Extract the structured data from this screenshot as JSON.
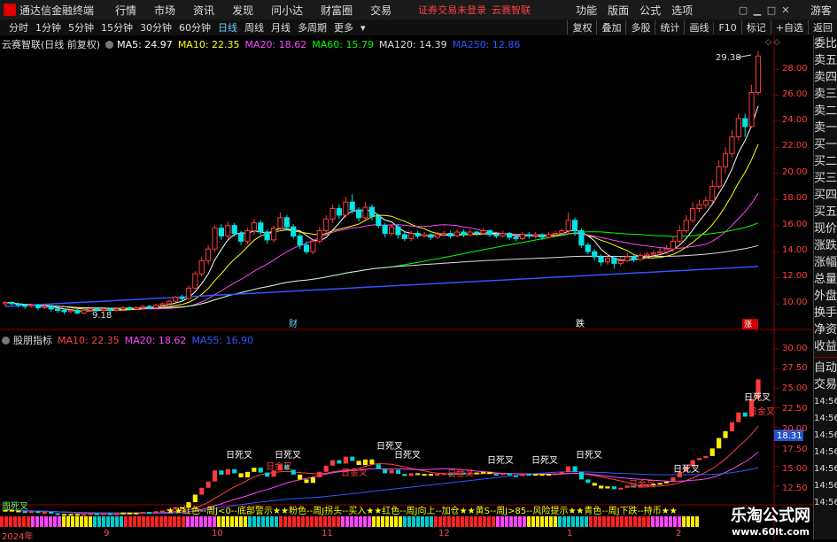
{
  "menubar": {
    "title": "通达信金融终端",
    "items": [
      "行情",
      "市场",
      "资讯",
      "发现",
      "问小达",
      "财富圈",
      "交易"
    ],
    "warning": "证券交易未登录",
    "stock": "云赛智联",
    "right_items": [
      "功能",
      "版面",
      "公式",
      "选项"
    ],
    "user": "游客"
  },
  "periods": {
    "tabs": [
      "分时",
      "1分钟",
      "5分钟",
      "15分钟",
      "30分钟",
      "60分钟",
      "日线",
      "周线",
      "月线",
      "多周期",
      "更多"
    ],
    "active": "日线",
    "right_tabs": [
      "复权",
      "叠加",
      "多股",
      "统计",
      "画线",
      "F10",
      "标记",
      "+自选",
      "返回"
    ]
  },
  "main_legend": {
    "name": "云赛智联(日线 前复权)",
    "ma": [
      {
        "label": "MA5: 24.97",
        "color": "#ffffff"
      },
      {
        "label": "MA10: 22.35",
        "color": "#ffff00"
      },
      {
        "label": "MA20: 18.62",
        "color": "#ff44ff"
      },
      {
        "label": "MA60: 15.79",
        "color": "#00ff00"
      },
      {
        "label": "MA120: 14.39",
        "color": "#dddddd"
      },
      {
        "label": "MA250: 12.86",
        "color": "#3355ff"
      }
    ]
  },
  "sub_legend": {
    "name": "股朋指标",
    "ma": [
      {
        "label": "MA10: 22.35",
        "color": "#ff4444"
      },
      {
        "label": "MA20: 18.62",
        "color": "#ff44ff"
      },
      {
        "label": "MA55: 16.90",
        "color": "#3355ff"
      }
    ]
  },
  "main_axis": [
    "28.00",
    "26.00",
    "24.00",
    "22.00",
    "20.00",
    "18.00",
    "16.00",
    "14.00",
    "12.00",
    "10.00"
  ],
  "sub_axis": [
    "30.00",
    "27.50",
    "25.00",
    "22.50",
    "20.00",
    "17.50",
    "15.00",
    "12.50"
  ],
  "sub_current": "18.31",
  "annotations": {
    "high": "29.38",
    "low": "9.18",
    "markers": [
      "财",
      "跌",
      "涨"
    ]
  },
  "sub_tags": [
    "日死叉",
    "日金叉"
  ],
  "ticker_text": "★★红色--周J<0--底部警示★★粉色--周J拐头--买入★★红色--周J向上--加仓★★黄S--周J>85--风险提示★★青色--周J下跌--持币★★",
  "ticker_left": "周死叉",
  "x_labels": [
    "2024年",
    "9",
    "10",
    "11",
    "12",
    "1",
    "2"
  ],
  "side_panel": [
    "委比",
    "卖五",
    "卖四",
    "卖三",
    "卖二",
    "卖一",
    "买一",
    "买二",
    "买三",
    "买四",
    "买五",
    "现价",
    "涨跌",
    "涨幅",
    "总量",
    "外盘",
    "换手",
    "净资",
    "收益"
  ],
  "side_panel2": [
    "自动",
    "交易"
  ],
  "side_times": [
    "14:56",
    "14:56",
    "14:56",
    "14:56",
    "14:56",
    "14:56",
    "14:56",
    "14:56"
  ],
  "watermark": {
    "line1": "乐淘公式网",
    "line2": "www.60lt.com"
  },
  "chart_data": {
    "type": "candlestick",
    "title": "云赛智联(日线 前复权)",
    "ylim": [
      9.0,
      30.0
    ],
    "candles": [
      [
        10.0,
        10.1,
        9.8,
        10.2
      ],
      [
        10.1,
        10.0,
        9.9,
        10.2
      ],
      [
        10.0,
        9.9,
        9.7,
        10.1
      ],
      [
        9.9,
        9.8,
        9.6,
        10.0
      ],
      [
        9.8,
        9.9,
        9.7,
        10.0
      ],
      [
        9.9,
        9.7,
        9.5,
        10.0
      ],
      [
        9.7,
        9.8,
        9.6,
        9.9
      ],
      [
        9.8,
        9.6,
        9.4,
        9.9
      ],
      [
        9.6,
        9.5,
        9.3,
        9.7
      ],
      [
        9.5,
        9.4,
        9.2,
        9.6
      ],
      [
        9.4,
        9.5,
        9.3,
        9.6
      ],
      [
        9.5,
        9.3,
        9.18,
        9.6
      ],
      [
        9.3,
        9.5,
        9.2,
        9.6
      ],
      [
        9.5,
        9.6,
        9.4,
        9.7
      ],
      [
        9.6,
        9.5,
        9.4,
        9.7
      ],
      [
        9.5,
        9.6,
        9.4,
        9.7
      ],
      [
        9.6,
        9.5,
        9.3,
        9.7
      ],
      [
        9.5,
        9.6,
        9.4,
        9.7
      ],
      [
        9.6,
        9.7,
        9.5,
        9.8
      ],
      [
        9.7,
        9.6,
        9.5,
        9.8
      ],
      [
        9.6,
        9.7,
        9.5,
        9.8
      ],
      [
        9.7,
        9.8,
        9.6,
        9.9
      ],
      [
        9.8,
        9.7,
        9.6,
        9.9
      ],
      [
        9.7,
        9.9,
        9.6,
        10.0
      ],
      [
        9.9,
        10.0,
        9.8,
        10.1
      ],
      [
        10.0,
        10.2,
        9.9,
        10.3
      ],
      [
        10.2,
        10.5,
        10.1,
        10.6
      ],
      [
        10.5,
        10.4,
        10.2,
        10.7
      ],
      [
        10.4,
        11.2,
        10.3,
        11.4
      ],
      [
        11.2,
        12.3,
        11.1,
        12.5
      ],
      [
        12.3,
        13.3,
        12.1,
        13.6
      ],
      [
        13.3,
        14.2,
        13.0,
        14.5
      ],
      [
        14.2,
        15.8,
        14.0,
        16.0
      ],
      [
        15.8,
        15.2,
        14.9,
        16.1
      ],
      [
        15.2,
        16.0,
        15.0,
        16.3
      ],
      [
        16.0,
        15.4,
        15.1,
        16.2
      ],
      [
        15.4,
        14.8,
        14.5,
        15.6
      ],
      [
        14.8,
        15.6,
        14.6,
        15.8
      ],
      [
        15.6,
        16.2,
        15.3,
        16.5
      ],
      [
        16.2,
        15.5,
        15.3,
        16.4
      ],
      [
        15.5,
        14.9,
        14.6,
        15.7
      ],
      [
        14.9,
        15.8,
        14.7,
        16.0
      ],
      [
        15.8,
        16.6,
        15.6,
        17.0
      ],
      [
        16.6,
        15.9,
        15.6,
        16.8
      ],
      [
        15.9,
        15.2,
        15.0,
        16.1
      ],
      [
        15.2,
        14.5,
        14.2,
        15.4
      ],
      [
        14.5,
        14.0,
        13.8,
        14.8
      ],
      [
        14.0,
        14.8,
        13.8,
        15.0
      ],
      [
        14.8,
        15.6,
        14.6,
        15.9
      ],
      [
        15.6,
        16.5,
        15.4,
        16.8
      ],
      [
        16.5,
        17.3,
        16.2,
        17.6
      ],
      [
        17.3,
        16.8,
        16.5,
        17.6
      ],
      [
        16.8,
        17.8,
        16.6,
        18.2
      ],
      [
        17.8,
        17.2,
        16.9,
        18.4
      ],
      [
        17.2,
        16.6,
        16.3,
        17.4
      ],
      [
        16.6,
        17.4,
        16.4,
        17.8
      ],
      [
        17.4,
        16.7,
        16.4,
        17.6
      ],
      [
        16.7,
        16.0,
        15.8,
        16.9
      ],
      [
        16.0,
        15.4,
        15.1,
        16.2
      ],
      [
        15.4,
        15.9,
        15.2,
        16.1
      ],
      [
        15.9,
        15.3,
        15.0,
        16.1
      ],
      [
        15.3,
        15.0,
        14.8,
        15.5
      ],
      [
        15.0,
        15.4,
        14.8,
        15.6
      ],
      [
        15.4,
        15.2,
        15.0,
        15.6
      ],
      [
        15.2,
        15.3,
        15.1,
        15.5
      ],
      [
        15.3,
        15.1,
        14.9,
        15.4
      ],
      [
        15.1,
        15.3,
        15.0,
        15.5
      ],
      [
        15.3,
        15.4,
        15.2,
        15.6
      ],
      [
        15.4,
        15.2,
        15.0,
        15.6
      ],
      [
        15.2,
        15.5,
        15.1,
        15.7
      ],
      [
        15.5,
        15.3,
        15.1,
        15.7
      ],
      [
        15.3,
        15.5,
        15.2,
        15.7
      ],
      [
        15.5,
        15.4,
        15.2,
        15.6
      ],
      [
        15.4,
        15.6,
        15.3,
        15.8
      ],
      [
        15.6,
        15.3,
        15.1,
        15.7
      ],
      [
        15.3,
        15.2,
        15.0,
        15.5
      ],
      [
        15.2,
        15.4,
        15.1,
        15.6
      ],
      [
        15.4,
        15.1,
        14.9,
        15.5
      ],
      [
        15.1,
        15.0,
        14.8,
        15.3
      ],
      [
        15.0,
        15.3,
        14.9,
        15.5
      ],
      [
        15.3,
        15.2,
        15.0,
        15.5
      ],
      [
        15.2,
        15.3,
        15.0,
        15.5
      ],
      [
        15.3,
        15.1,
        14.9,
        15.4
      ],
      [
        15.1,
        15.3,
        15.0,
        15.5
      ],
      [
        15.3,
        15.4,
        15.2,
        15.6
      ],
      [
        15.4,
        15.6,
        15.3,
        15.8
      ],
      [
        15.6,
        16.4,
        15.4,
        17.0
      ],
      [
        16.4,
        15.6,
        15.2,
        16.6
      ],
      [
        15.6,
        14.5,
        14.3,
        15.8
      ],
      [
        14.5,
        14.0,
        13.8,
        14.7
      ],
      [
        14.0,
        13.6,
        13.3,
        14.2
      ],
      [
        13.6,
        13.2,
        12.9,
        13.8
      ],
      [
        13.2,
        13.5,
        13.0,
        13.8
      ],
      [
        13.5,
        13.1,
        12.7,
        13.7
      ],
      [
        13.1,
        13.3,
        12.9,
        13.6
      ],
      [
        13.3,
        13.6,
        13.2,
        13.9
      ],
      [
        13.6,
        13.4,
        13.2,
        13.8
      ],
      [
        13.4,
        13.7,
        13.3,
        13.9
      ],
      [
        13.7,
        13.8,
        13.5,
        14.0
      ],
      [
        13.8,
        13.9,
        13.6,
        14.1
      ],
      [
        13.9,
        14.0,
        13.7,
        14.3
      ],
      [
        14.0,
        14.2,
        13.8,
        14.5
      ],
      [
        14.2,
        14.8,
        14.0,
        15.2
      ],
      [
        14.8,
        15.6,
        14.6,
        16.0
      ],
      [
        15.6,
        16.4,
        15.4,
        16.8
      ],
      [
        16.4,
        17.3,
        16.2,
        17.8
      ],
      [
        17.3,
        17.6,
        17.0,
        18.0
      ],
      [
        17.6,
        17.9,
        17.3,
        18.2
      ],
      [
        17.9,
        19.0,
        17.7,
        19.5
      ],
      [
        19.0,
        20.5,
        18.8,
        21.0
      ],
      [
        20.5,
        21.5,
        20.0,
        22.0
      ],
      [
        21.5,
        22.8,
        21.2,
        23.3
      ],
      [
        22.8,
        24.2,
        22.5,
        24.6
      ],
      [
        24.2,
        23.6,
        22.8,
        24.6
      ],
      [
        23.6,
        26.2,
        23.5,
        26.8
      ],
      [
        26.2,
        29.0,
        26.0,
        29.38
      ]
    ],
    "ma5_end": 24.97,
    "ma10_end": 22.35,
    "ma20_end": 18.62,
    "ma60_end": 15.79,
    "ma120_end": 14.39,
    "ma250_end": 12.86
  }
}
